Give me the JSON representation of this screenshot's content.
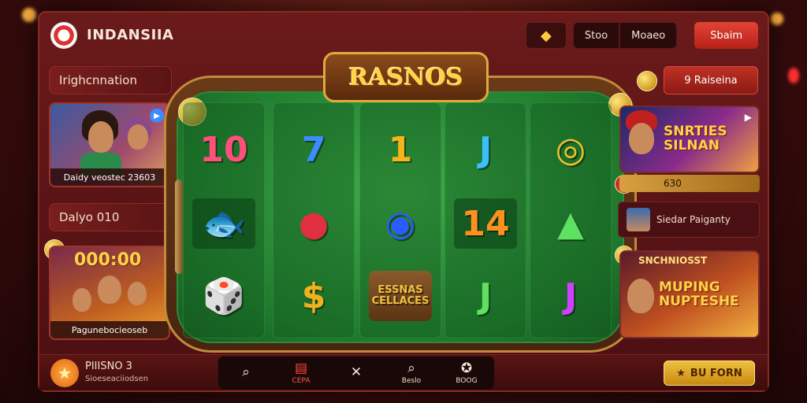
{
  "header": {
    "brand": "INDANSIIA",
    "stop_label": "Stoo",
    "mode_label": "Moaeo",
    "signin_label": "Sbaim"
  },
  "table": {
    "title": "RASNOS",
    "reels": [
      [
        {
          "text": "10",
          "color": "#ff4f7a"
        },
        {
          "text": "🐟",
          "color": "#f0b030"
        },
        {
          "text": "🎲",
          "color": "#ffffff"
        }
      ],
      [
        {
          "text": "7",
          "color": "#3a8cff"
        },
        {
          "text": "●",
          "color": "#e03040"
        },
        {
          "text": "$",
          "color": "#f0b020"
        }
      ],
      [
        {
          "text": "1",
          "color": "#f4b41a"
        },
        {
          "text": "◉",
          "color": "#2a5cff"
        },
        {
          "text": "ESSNAS CELLACES",
          "color": "#f0c040"
        }
      ],
      [
        {
          "text": "J",
          "color": "#3ac0ff"
        },
        {
          "text": "14",
          "color": "#ff9020"
        },
        {
          "text": "J",
          "color": "#5ee060"
        }
      ],
      [
        {
          "text": "◎",
          "color": "#f0c030"
        },
        {
          "text": "▲",
          "color": "#5ee060"
        },
        {
          "text": "J",
          "color": "#d040ff"
        }
      ]
    ]
  },
  "left": {
    "label_top": "Irighcnnation",
    "card1_caption": "Daidy veostec 23603",
    "label_mid": "Dalyo 010",
    "card2_amount": "000:00",
    "card2_caption": "Pagunebocieoseb"
  },
  "right": {
    "raise_label": "9 Raiseina",
    "card1_title": "SNRTIES SILNAN",
    "strip_value": "630",
    "row_label": "Siedar Paiganty",
    "card2_banner": "SNCHNIOSST",
    "card2_title": "MUPING NUPTESHE"
  },
  "bottom": {
    "title": "PIIISNO 3",
    "subtitle": "Sioeseaciiodsen",
    "nav": [
      {
        "icon": "search-icon",
        "glyph": "⌕",
        "label": ""
      },
      {
        "icon": "casino-icon",
        "glyph": "▤",
        "label": "CEPA"
      },
      {
        "icon": "cards-icon",
        "glyph": "✕",
        "label": ""
      },
      {
        "icon": "search-icon",
        "glyph": "⌕",
        "label": "Beslo"
      },
      {
        "icon": "star-icon",
        "glyph": "✪",
        "label": "BOOG"
      }
    ],
    "cta_label": "BU FORN"
  },
  "colors": {
    "accent_red": "#c03024",
    "gold": "#f0c040",
    "felt": "#2c8a38"
  }
}
